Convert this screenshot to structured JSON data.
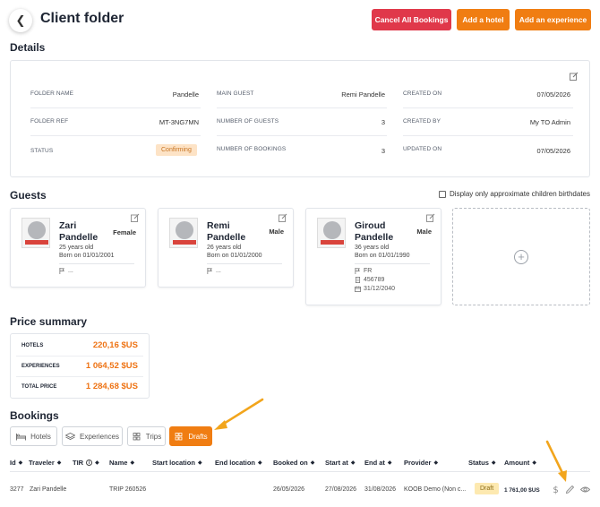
{
  "header": {
    "title": "Client folder",
    "buttons": {
      "cancel_all": "Cancel All Bookings",
      "add_hotel": "Add a hotel",
      "add_experience": "Add an experience"
    }
  },
  "details": {
    "title": "Details",
    "fields": {
      "folder_name": {
        "label": "FOLDER NAME",
        "value": "Pandelle"
      },
      "folder_ref": {
        "label": "FOLDER REF",
        "value": "MT-3NG7MN"
      },
      "status": {
        "label": "STATUS",
        "value": "Confirming"
      },
      "main_guest": {
        "label": "MAIN GUEST",
        "value": "Remi Pandelle"
      },
      "number_of_guests": {
        "label": "NUMBER OF GUESTS",
        "value": "3"
      },
      "number_of_bookings": {
        "label": "NUMBER OF BOOKINGS",
        "value": "3"
      },
      "created_on": {
        "label": "CREATED ON",
        "value": "07/05/2026"
      },
      "created_by": {
        "label": "CREATED BY",
        "value": "My TO Admin"
      },
      "updated_on": {
        "label": "UPDATED ON",
        "value": "07/05/2026"
      }
    }
  },
  "guests": {
    "title": "Guests",
    "approx_checkbox_label": "Display only approximate children birthdates",
    "list": [
      {
        "first": "Zari",
        "last": "Pandelle",
        "gender": "Female",
        "age": "25 years old",
        "born": "Born on 01/01/2001",
        "nationality": "...",
        "passport": "",
        "expiry": ""
      },
      {
        "first": "Remi",
        "last": "Pandelle",
        "gender": "Male",
        "age": "26 years old",
        "born": "Born on 01/01/2000",
        "nationality": "...",
        "passport": "",
        "expiry": ""
      },
      {
        "first": "Giroud",
        "last": "Pandelle",
        "gender": "Male",
        "age": "36 years old",
        "born": "Born on 01/01/1990",
        "nationality": "FR",
        "passport": "456789",
        "expiry": "31/12/2040"
      }
    ]
  },
  "price_summary": {
    "title": "Price summary",
    "rows": [
      {
        "label": "HOTELS",
        "value": "220,16 $US"
      },
      {
        "label": "EXPERIENCES",
        "value": "1 064,52 $US"
      },
      {
        "label": "TOTAL PRICE",
        "value": "1 284,68 $US"
      }
    ]
  },
  "bookings": {
    "title": "Bookings",
    "tabs": [
      {
        "label": "Hotels",
        "icon": "bed-icon"
      },
      {
        "label": "Experiences",
        "icon": "layers-icon"
      },
      {
        "label": "Trips",
        "icon": "grid-icon"
      },
      {
        "label": "Drafts",
        "icon": "grid-icon",
        "active": true
      }
    ],
    "columns": [
      "Id",
      "Traveler",
      "TIR",
      "Name",
      "Start location",
      "End location",
      "Booked on",
      "Start at",
      "End at",
      "Provider",
      "Status",
      "Amount"
    ],
    "rows": [
      {
        "id": "3277",
        "traveler": "Zari Pandelle",
        "tir": "",
        "name": "TRIP 260526",
        "start_location": "",
        "end_location": "",
        "booked_on": "26/05/2026",
        "start_at": "27/08/2026",
        "end_at": "31/08/2026",
        "provider": "KOOB Demo (Non c...",
        "status": "Draft",
        "amount": "1 761,00 $US"
      }
    ]
  },
  "colors": {
    "accent_orange": "#f07d12",
    "danger_red": "#e0384a",
    "price_orange": "#ee7314",
    "confirming_badge_bg": "#fde3c6",
    "draft_badge_bg": "#fde9b0",
    "annotation_arrow": "#f2a51c"
  }
}
